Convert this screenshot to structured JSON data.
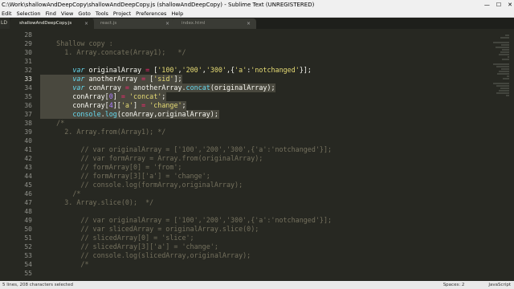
{
  "window": {
    "title": "C:\\Work\\shallowAndDeepCopy\\shallowAndDeepCopy.js (shallowAndDeepCopy) - Sublime Text (UNREGISTERED)",
    "controls": [
      "—",
      "☐",
      "✕"
    ]
  },
  "menu": [
    "Edit",
    "Selection",
    "Find",
    "View",
    "Goto",
    "Tools",
    "Project",
    "Preferences",
    "Help"
  ],
  "sidebar_stub": "LD",
  "tabs": [
    {
      "label": "shallowAndDeepCopy.js",
      "active": true,
      "close": "×"
    },
    {
      "label": "react.js",
      "active": false,
      "close": "×"
    },
    {
      "label": "index.html",
      "active": false,
      "close": "×"
    }
  ],
  "editor": {
    "lines": [
      {
        "num": "28",
        "tokens": [
          {
            "t": "",
            "c": ""
          }
        ]
      },
      {
        "num": "29",
        "tokens": [
          {
            "t": "    Shallow copy :",
            "c": "c"
          }
        ]
      },
      {
        "num": "30",
        "tokens": [
          {
            "t": "      1. Array.concate(Array1);   */",
            "c": "c"
          }
        ]
      },
      {
        "num": "31",
        "tokens": [
          {
            "t": "",
            "c": ""
          }
        ]
      },
      {
        "num": "32",
        "tokens": [
          {
            "t": "        ",
            "c": ""
          },
          {
            "t": "var",
            "c": "k"
          },
          {
            "t": " originalArray ",
            "c": ""
          },
          {
            "t": "=",
            "c": "o"
          },
          {
            "t": " [",
            "c": ""
          },
          {
            "t": "'100'",
            "c": "s"
          },
          {
            "t": ",",
            "c": ""
          },
          {
            "t": "'200'",
            "c": "s"
          },
          {
            "t": ",",
            "c": ""
          },
          {
            "t": "'300'",
            "c": "s"
          },
          {
            "t": ",{",
            "c": ""
          },
          {
            "t": "'a'",
            "c": "s"
          },
          {
            "t": ":",
            "c": ""
          },
          {
            "t": "'notchanged'",
            "c": "s"
          },
          {
            "t": "}];",
            "c": ""
          }
        ]
      },
      {
        "num": "33",
        "tokens": [
          {
            "t": "        ",
            "c": ""
          },
          {
            "t": "var",
            "c": "k"
          },
          {
            "t": " anotherArray ",
            "c": ""
          },
          {
            "t": "=",
            "c": "o"
          },
          {
            "t": " [",
            "c": ""
          },
          {
            "t": "'sid'",
            "c": "s"
          },
          {
            "t": "];",
            "c": ""
          }
        ]
      },
      {
        "num": "34",
        "tokens": [
          {
            "t": "        ",
            "c": ""
          },
          {
            "t": "var",
            "c": "k"
          },
          {
            "t": " conArray ",
            "c": ""
          },
          {
            "t": "=",
            "c": "o"
          },
          {
            "t": " anotherArray.",
            "c": ""
          },
          {
            "t": "concat",
            "c": "f"
          },
          {
            "t": "(originalArray);",
            "c": ""
          }
        ]
      },
      {
        "num": "35",
        "tokens": [
          {
            "t": "        conArray[",
            "c": ""
          },
          {
            "t": "0",
            "c": "n"
          },
          {
            "t": "] ",
            "c": ""
          },
          {
            "t": "=",
            "c": "o"
          },
          {
            "t": " ",
            "c": ""
          },
          {
            "t": "'concat'",
            "c": "s"
          },
          {
            "t": ";",
            "c": ""
          }
        ]
      },
      {
        "num": "36",
        "tokens": [
          {
            "t": "        conArray[",
            "c": ""
          },
          {
            "t": "4",
            "c": "n"
          },
          {
            "t": "][",
            "c": ""
          },
          {
            "t": "'a'",
            "c": "s"
          },
          {
            "t": "] ",
            "c": ""
          },
          {
            "t": "=",
            "c": "o"
          },
          {
            "t": " ",
            "c": ""
          },
          {
            "t": "'change'",
            "c": "s"
          },
          {
            "t": ";",
            "c": ""
          }
        ]
      },
      {
        "num": "37",
        "tokens": [
          {
            "t": "        ",
            "c": ""
          },
          {
            "t": "console",
            "c": "f"
          },
          {
            "t": ".",
            "c": ""
          },
          {
            "t": "log",
            "c": "f"
          },
          {
            "t": "(conArray,originalArray);",
            "c": ""
          }
        ]
      },
      {
        "num": "38",
        "tokens": [
          {
            "t": "    /*",
            "c": "c"
          }
        ]
      },
      {
        "num": "39",
        "tokens": [
          {
            "t": "      2. Array.from(Array1); */",
            "c": "c"
          }
        ]
      },
      {
        "num": "40",
        "tokens": [
          {
            "t": "",
            "c": ""
          }
        ]
      },
      {
        "num": "41",
        "tokens": [
          {
            "t": "          // var originalArray = ['100','200','300',{'a':'notchanged'}];",
            "c": "c"
          }
        ]
      },
      {
        "num": "42",
        "tokens": [
          {
            "t": "          // var formArray = Array.from(originalArray);",
            "c": "c"
          }
        ]
      },
      {
        "num": "43",
        "tokens": [
          {
            "t": "          // formArray[0] = 'from';",
            "c": "c"
          }
        ]
      },
      {
        "num": "44",
        "tokens": [
          {
            "t": "          // formArray[3]['a'] = 'change';",
            "c": "c"
          }
        ]
      },
      {
        "num": "45",
        "tokens": [
          {
            "t": "          // console.log(formArray,originalArray);",
            "c": "c"
          }
        ]
      },
      {
        "num": "46",
        "tokens": [
          {
            "t": "        /*",
            "c": "c"
          }
        ]
      },
      {
        "num": "47",
        "tokens": [
          {
            "t": "      3. Array.slice(0);  */",
            "c": "c"
          }
        ]
      },
      {
        "num": "48",
        "tokens": [
          {
            "t": "",
            "c": ""
          }
        ]
      },
      {
        "num": "49",
        "tokens": [
          {
            "t": "          // var originalArray = ['100','200','300',{'a':'notchanged'}];",
            "c": "c"
          }
        ]
      },
      {
        "num": "50",
        "tokens": [
          {
            "t": "          // var slicedArray = originalArray.slice(0);",
            "c": "c"
          }
        ]
      },
      {
        "num": "51",
        "tokens": [
          {
            "t": "          // slicedArray[0] = 'slice';",
            "c": "c"
          }
        ]
      },
      {
        "num": "52",
        "tokens": [
          {
            "t": "          // slicedArray[3]['a'] = 'change';",
            "c": "c"
          }
        ]
      },
      {
        "num": "53",
        "tokens": [
          {
            "t": "          // console.log(slicedArray,originalArray);",
            "c": "c"
          }
        ]
      },
      {
        "num": "54",
        "tokens": [
          {
            "t": "          /*",
            "c": "c"
          }
        ]
      },
      {
        "num": "55",
        "tokens": [
          {
            "t": "",
            "c": ""
          }
        ]
      }
    ],
    "current_line": "33",
    "selected_lines": [
      "33",
      "34",
      "35",
      "36",
      "37"
    ]
  },
  "status": {
    "left": "5 lines, 208 characters selected",
    "spaces": "Spaces: 2",
    "syntax": "JavaScript"
  },
  "colors": {
    "background": "#272822",
    "keyword": "#66d9ef",
    "string": "#e6db74",
    "operator": "#f92672",
    "number": "#ae81ff",
    "comment": "#75715e",
    "selection": "#49483e"
  }
}
